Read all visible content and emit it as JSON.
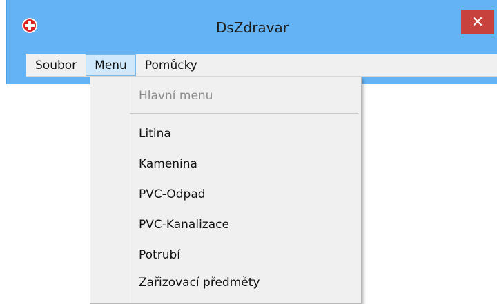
{
  "window": {
    "title": "DsZdravar",
    "icon": "app-red-cross-icon",
    "close_symbol": "✕"
  },
  "menubar": {
    "items": [
      {
        "label": "Soubor"
      },
      {
        "label": "Menu",
        "active": true
      },
      {
        "label": "Pomůcky"
      }
    ]
  },
  "dropdown": {
    "header": "Hlavní menu",
    "items": [
      {
        "label": "Litina"
      },
      {
        "label": "Kamenina"
      },
      {
        "label": "PVC-Odpad"
      },
      {
        "label": "PVC-Kanalizace"
      },
      {
        "label": "Potrubí"
      },
      {
        "label": "Zařizovací předměty"
      }
    ]
  },
  "colors": {
    "titlebar": "#64b4f5",
    "close_button": "#c8423d",
    "active_menu_bg": "#cfe8fb"
  }
}
